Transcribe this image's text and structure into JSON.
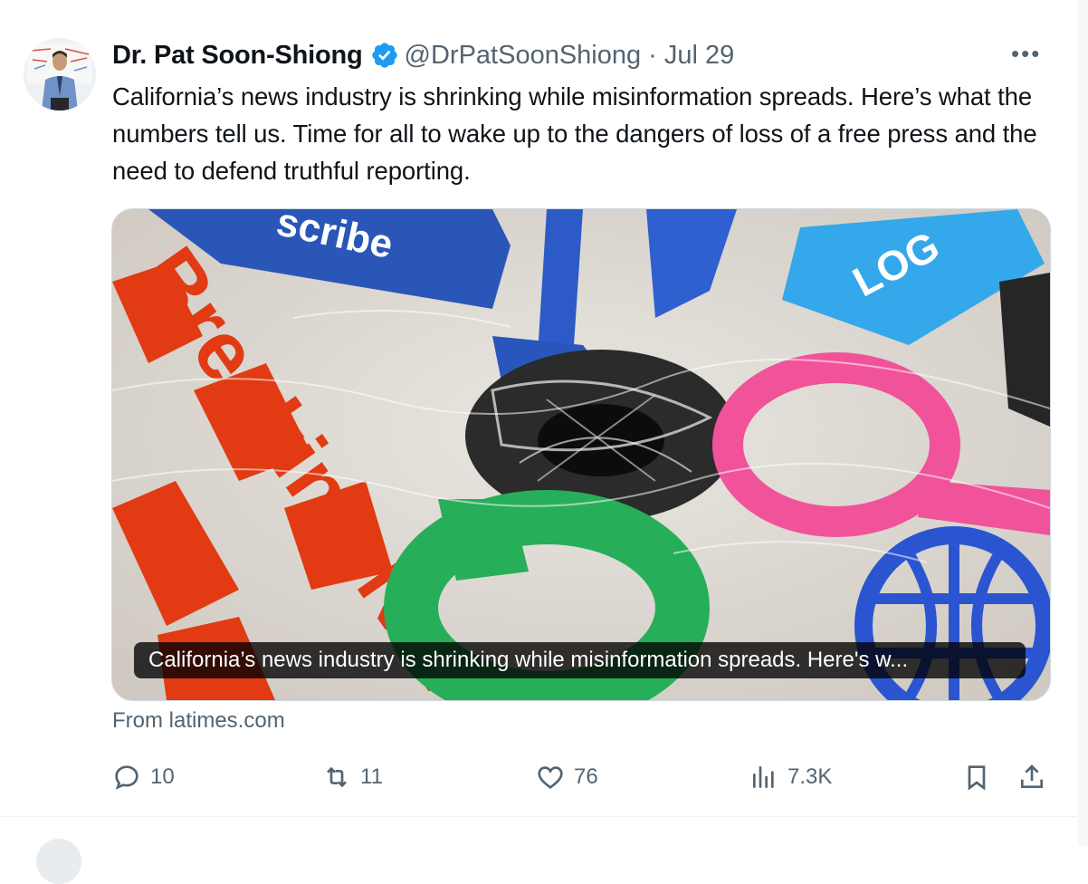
{
  "tweet": {
    "author_name": "Dr. Pat Soon-Shiong",
    "handle_time": "@DrPatSoonShiong · Jul 29",
    "body": "California’s news industry is shrinking while misinformation spreads. Here’s what the numbers tell us. Time for all to wake up to the dangers of loss of a free press and the need to defend truthful reporting.",
    "media": {
      "caption": "California’s news industry is shrinking while misinformation spreads. Here's w...",
      "image_text": {
        "subscribe_fragment": "scribe",
        "login_fragment": "LOG",
        "breaking_news": "Breaking News"
      }
    },
    "source": "From latimes.com",
    "actions": {
      "replies": "10",
      "reposts": "11",
      "likes": "76",
      "views": "7.3K"
    }
  },
  "icons": {
    "verified": "verified-badge-icon",
    "more": "more-icon",
    "reply": "reply-icon",
    "repost": "repost-icon",
    "like": "like-icon",
    "views": "views-icon",
    "bookmark": "bookmark-icon",
    "share": "share-icon"
  },
  "colors": {
    "verified_blue": "#1d9bf0",
    "muted_text": "#536471",
    "primary_text": "#0f1419"
  }
}
